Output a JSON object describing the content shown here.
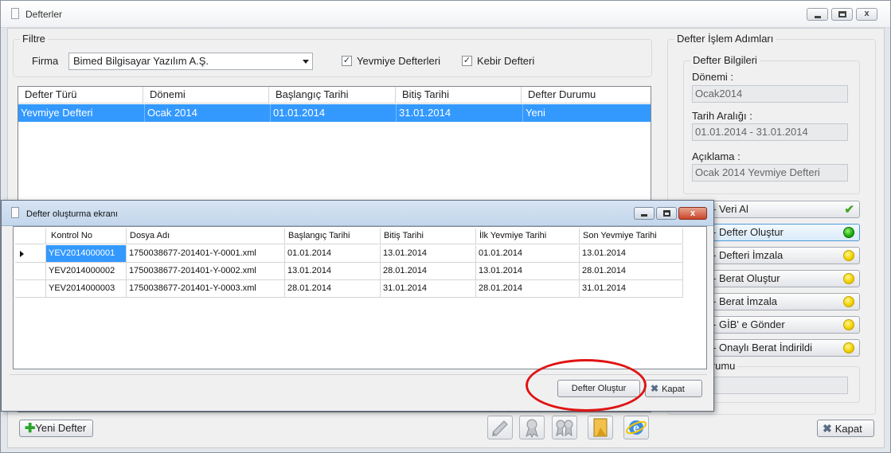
{
  "window": {
    "title": "Defterler"
  },
  "filter": {
    "group_title": "Filtre",
    "firma_label": "Firma",
    "firma_value": "Bimed Bilgisayar Yazılım A.Ş.",
    "yevmiye_label": "Yevmiye Defterleri",
    "yevmiye_checked": "✓",
    "kebir_label": "Kebir Defteri",
    "kebir_checked": "✓"
  },
  "grid": {
    "columns": [
      "Defter Türü",
      "Dönemi",
      "Başlangıç Tarihi",
      "Bitiş Tarihi",
      "Defter Durumu"
    ],
    "rows": [
      [
        "Yevmiye Defteri",
        "Ocak 2014",
        "01.01.2014",
        "31.01.2014",
        "Yeni"
      ]
    ]
  },
  "right_panel": {
    "group_title": "Defter İşlem Adımları",
    "info_title": "Defter Bilgileri",
    "donemi_label": "Dönemi :",
    "donemi_value": "Ocak2014",
    "tarih_label": "Tarih Aralığı :",
    "tarih_value": "01.01.2014 - 31.01.2014",
    "aciklama_label": "Açıklama :",
    "aciklama_value": "Ocak 2014 Yevmiye Defteri",
    "steps": [
      {
        "label": "ım - Veri Al",
        "status": "done"
      },
      {
        "label": "ım - Defter Oluştur",
        "status": "active"
      },
      {
        "label": "ım - Defteri İmzala",
        "status": "pending"
      },
      {
        "label": "ım - Berat Oluştur",
        "status": "pending"
      },
      {
        "label": "ım - Berat İmzala",
        "status": "pending"
      },
      {
        "label": "ım - GİB' e Gönder",
        "status": "pending"
      },
      {
        "label": "ım - Onaylı Berat İndirildi",
        "status": "pending"
      }
    ],
    "durum_title": "er Durumu",
    "durum_value": ""
  },
  "bottom": {
    "new_label": "Yeni Defter",
    "close_label": "Kapat"
  },
  "dialog": {
    "title": "Defter oluşturma ekranı",
    "columns": [
      "Kontrol No",
      "Dosya Adı",
      "Başlangıç Tarihi",
      "Bitiş Tarihi",
      "İlk Yevmiye Tarihi",
      "Son Yevmiye Tarihi"
    ],
    "rows": [
      [
        "YEV2014000001",
        "1750038677-201401-Y-0001.xml",
        "01.01.2014",
        "13.01.2014",
        "01.01.2014",
        "13.01.2014"
      ],
      [
        "YEV2014000002",
        "1750038677-201401-Y-0002.xml",
        "13.01.2014",
        "28.01.2014",
        "13.01.2014",
        "28.01.2014"
      ],
      [
        "YEV2014000003",
        "1750038677-201401-Y-0003.xml",
        "28.01.2014",
        "31.01.2014",
        "28.01.2014",
        "31.01.2014"
      ]
    ],
    "create_label": "Defter Oluştur",
    "close_label": "Kapat",
    "close_glyph": "x"
  },
  "colors": {
    "selection": "#3399ff",
    "highlight_ellipse": "#e01414"
  }
}
